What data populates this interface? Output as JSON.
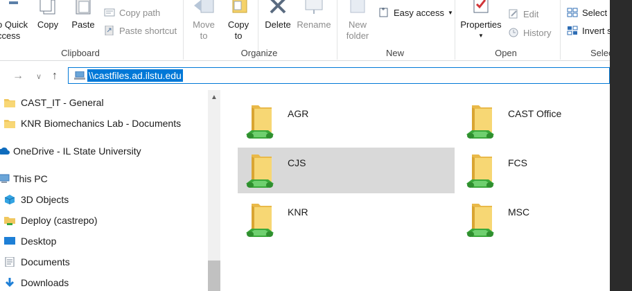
{
  "ribbon": {
    "clipboard": {
      "pin_label_line1": "o Quick",
      "pin_label_line2": "ccess",
      "copy": "Copy",
      "paste": "Paste",
      "copy_path": "Copy path",
      "paste_shortcut": "Paste shortcut",
      "group": "Clipboard"
    },
    "organize": {
      "move_to_line1": "Move",
      "move_to_line2": "to",
      "copy_to_line1": "Copy",
      "copy_to_line2": "to",
      "delete": "Delete",
      "rename": "Rename",
      "group": "Organize"
    },
    "new": {
      "new_folder_line1": "New",
      "new_folder_line2": "folder",
      "easy_access": "Easy access",
      "group": "New"
    },
    "open": {
      "properties": "Properties",
      "edit": "Edit",
      "history": "History",
      "group": "Open"
    },
    "select": {
      "select_all": "Select r",
      "invert_selection": "Invert s",
      "group": "Selec"
    }
  },
  "address": {
    "path": "\\\\castfiles.ad.ilstu.edu"
  },
  "nav_pane": {
    "items": [
      {
        "label": "CAST_IT - General",
        "icon": "folder-icon"
      },
      {
        "label": "KNR Biomechanics Lab - Documents",
        "icon": "folder-icon"
      },
      {
        "label": "OneDrive - IL State University",
        "icon": "cloud-icon"
      },
      {
        "label": "This PC",
        "icon": "computer-icon"
      },
      {
        "label": "3D Objects",
        "icon": "cube-icon"
      },
      {
        "label": "Deploy (castrepo)",
        "icon": "network-drive-icon"
      },
      {
        "label": "Desktop",
        "icon": "desktop-icon"
      },
      {
        "label": "Documents",
        "icon": "documents-icon"
      },
      {
        "label": "Downloads",
        "icon": "download-icon"
      }
    ]
  },
  "shares": [
    {
      "name": "AGR",
      "selected": false
    },
    {
      "name": "CAST Office",
      "selected": false
    },
    {
      "name": "CJS",
      "selected": true
    },
    {
      "name": "FCS",
      "selected": false
    },
    {
      "name": "KNR",
      "selected": false
    },
    {
      "name": "MSC",
      "selected": false
    }
  ],
  "colors": {
    "accent": "#0078d7",
    "selection": "#d9d9d9",
    "folder": "#f5d26a",
    "share_green": "#3aa83a"
  }
}
